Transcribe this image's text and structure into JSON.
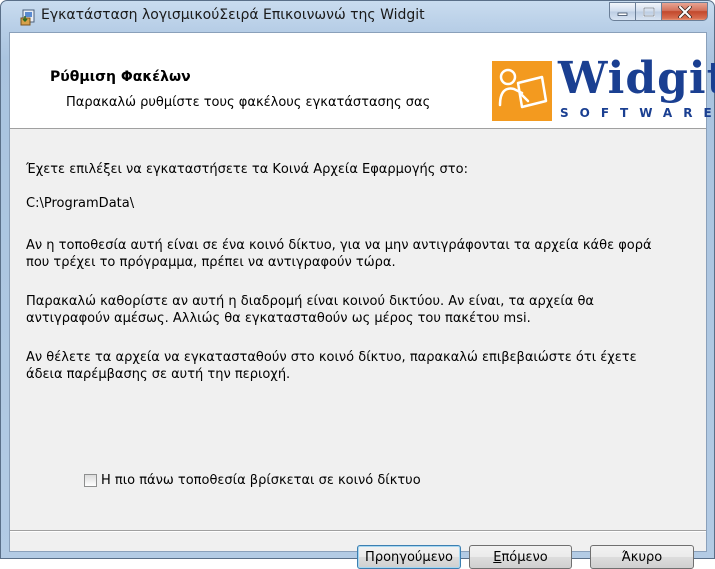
{
  "window": {
    "title": "Εγκατάσταση λογισμικούΣειρά Επικοινωνώ της Widgit",
    "minimize_icon": "minimize-icon",
    "maximize_icon": "maximize-icon",
    "close_icon": "close-icon"
  },
  "banner": {
    "title": "Ρύθμιση Φακέλων",
    "subtitle": "Παρακαλώ ρυθμίστε τους φακέλους εγκατάστασης σας",
    "logo_word": "Widgit",
    "logo_sub": "SOFTWARE",
    "logo_color": "#f39a1f",
    "logo_text_color": "#1a3f91"
  },
  "body": {
    "line1": "Έχετε επιλέξει να εγκαταστήσετε τα Κοινά Αρχεία Εφαρμογής στο:",
    "path": "C:\\ProgramData\\",
    "para1_a": "Αν η τοποθεσία αυτή είναι σε ένα κοινό δίκτυο, για να μην αντιγράφονται τα αρχεία κάθε φορά",
    "para1_b": "που τρέχει το πρόγραμμα, πρέπει να αντιγραφούν τώρα.",
    "para2_a": "Παρακαλώ καθορίστε αν αυτή η διαδρομή είναι κοινού δικτύου. Αν είναι, τα αρχεία θα",
    "para2_b": "αντιγραφούν αμέσως. Αλλιώς θα εγκατασταθούν ως μέρος του πακέτου msi.",
    "para3_a": "Αν θέλετε τα αρχεία να εγκατασταθούν στο κοινό δίκτυο, παρακαλώ επιβεβαιώστε ότι έχετε",
    "para3_b": "άδεια παρέμβασης σε αυτή την περιοχή."
  },
  "checkbox": {
    "label": "Η πιο πάνω τοποθεσία βρίσκεται σε κοινό δίκτυο",
    "checked": false
  },
  "buttons": {
    "back": "Προηγούμενο",
    "next_first": "Ε",
    "next_rest": "πόμενο",
    "cancel": "Άκυρο"
  }
}
